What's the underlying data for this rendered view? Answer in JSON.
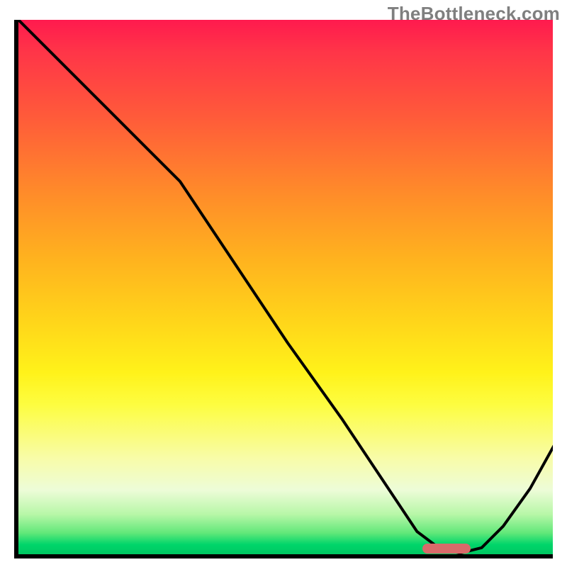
{
  "watermark": "TheBottleneck.com",
  "chart_data": {
    "type": "line",
    "title": "",
    "xlabel": "",
    "ylabel": "",
    "xlim": [
      0,
      100
    ],
    "ylim": [
      0,
      100
    ],
    "grid": false,
    "series": [
      {
        "name": "curve",
        "x": [
          0,
          16,
          24,
          30,
          40,
          50,
          60,
          70,
          74,
          78,
          82,
          86,
          90,
          95,
          100
        ],
        "values": [
          100,
          84,
          76,
          70,
          55,
          40,
          26,
          11,
          5,
          2,
          1,
          2,
          6,
          13,
          22
        ]
      }
    ],
    "marker": {
      "xStart": 75,
      "xEnd": 84,
      "y": 1.8
    },
    "colors": {
      "curve": "#000000",
      "marker": "#d86a6a"
    }
  }
}
